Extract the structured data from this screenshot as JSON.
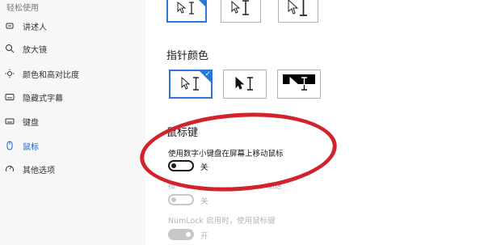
{
  "sidebar": {
    "section": "轻松使用",
    "items": [
      {
        "label": "讲述人",
        "icon": "narrator-icon"
      },
      {
        "label": "放大镜",
        "icon": "magnifier-icon"
      },
      {
        "label": "颜色和高对比度",
        "icon": "brightness-icon"
      },
      {
        "label": "隐藏式字幕",
        "icon": "captions-icon"
      },
      {
        "label": "键盘",
        "icon": "keyboard-icon"
      },
      {
        "label": "鼠标",
        "icon": "mouse-icon",
        "active": true
      },
      {
        "label": "其他选项",
        "icon": "other-options-icon"
      }
    ]
  },
  "main": {
    "pointer_size": {
      "options": [
        "small",
        "medium",
        "large"
      ],
      "selected": 0
    },
    "pointer_color": {
      "title": "指针颜色",
      "options": [
        "white",
        "black",
        "inverted"
      ],
      "selected": 0
    },
    "mouse_keys": {
      "title": "鼠标键",
      "toggle1": {
        "desc": "使用数字小键盘在屏幕上移动鼠标",
        "state": "关"
      },
      "toggle2": {
        "desc": "按",
        "desc_tail": "加速",
        "state": "关"
      },
      "toggle3": {
        "desc": "NumLock 启用时，使用鼠标键",
        "state": "开"
      }
    }
  },
  "colors": {
    "accent": "#2a78d7",
    "active_nav": "#2463c7",
    "annotation": "#d3232a"
  }
}
